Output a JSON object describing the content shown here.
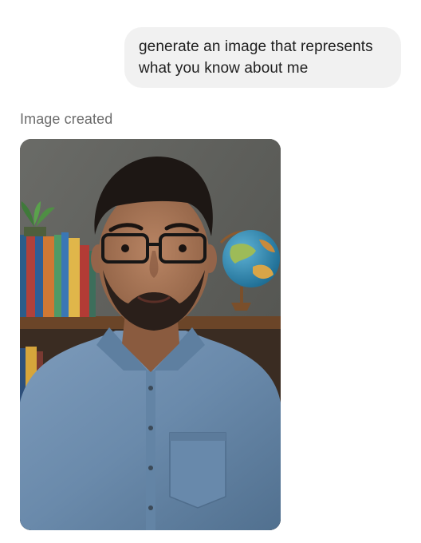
{
  "user_message": {
    "line1": "generate an image that represents",
    "line2": "what you know about me"
  },
  "assistant": {
    "status_label": "Image created",
    "image_subject": "man-portrait"
  },
  "colors": {
    "bubble_bg": "#f1f1f1",
    "status_text": "#6b6b6b",
    "shirt": "#6f8fae",
    "wall": "#5f605c"
  }
}
